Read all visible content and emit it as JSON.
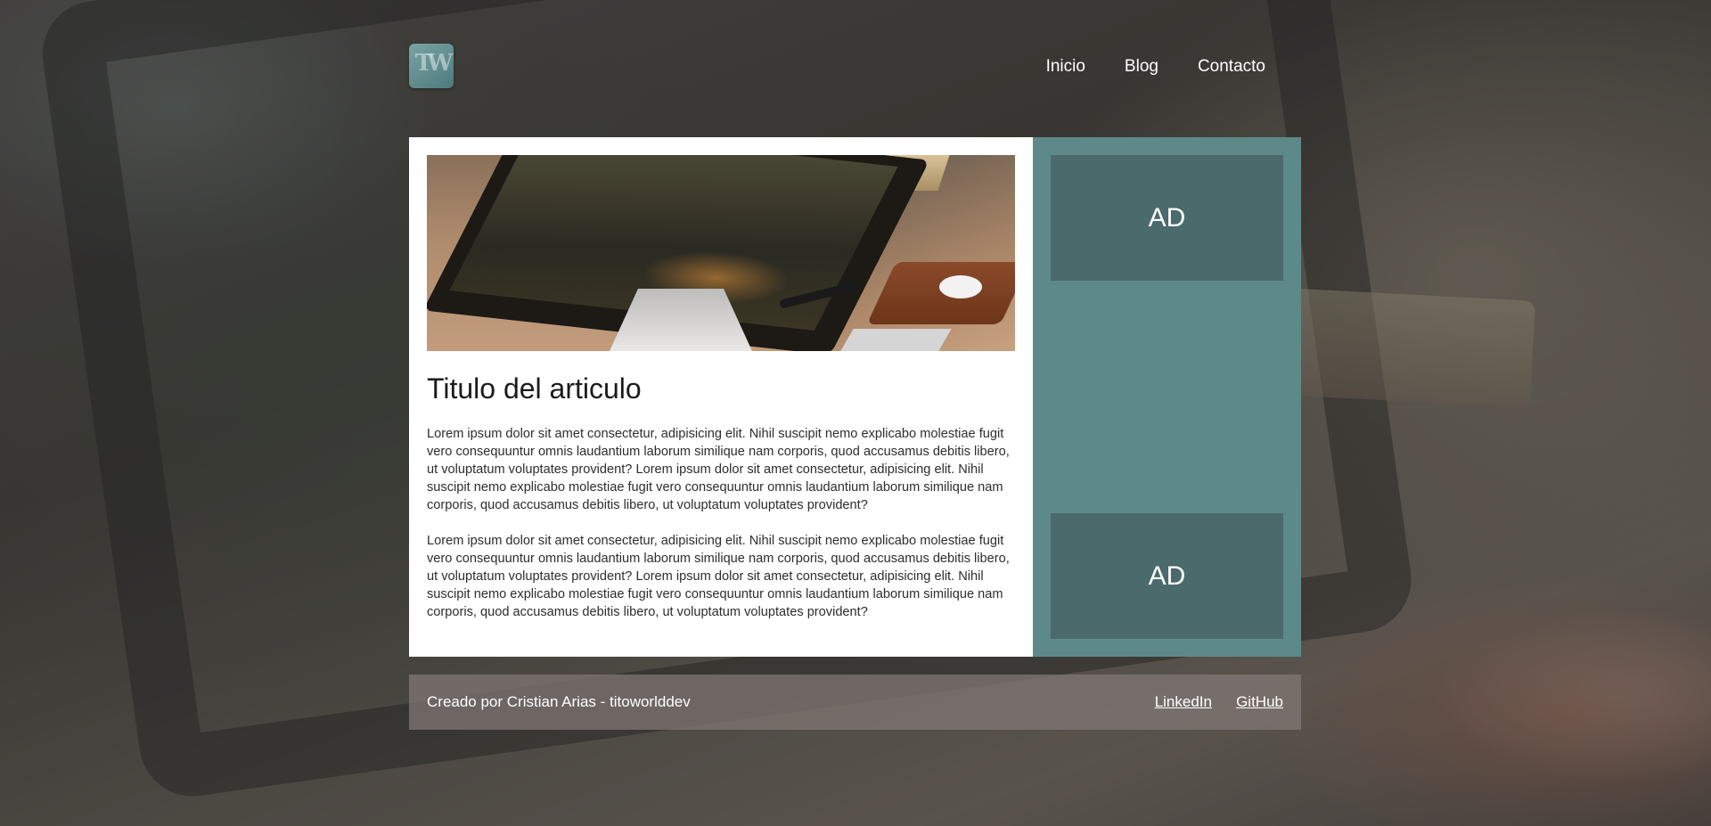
{
  "header": {
    "logo_text": "TW",
    "nav": {
      "inicio": "Inicio",
      "blog": "Blog",
      "contacto": "Contacto"
    }
  },
  "article": {
    "title": "Titulo del articulo",
    "paragraphs": [
      "Lorem ipsum dolor sit amet consectetur, adipisicing elit. Nihil suscipit nemo explicabo molestiae fugit vero consequuntur omnis laudantium laborum similique nam corporis, quod accusamus debitis libero, ut voluptatum voluptates provident? Lorem ipsum dolor sit amet consectetur, adipisicing elit. Nihil suscipit nemo explicabo molestiae fugit vero consequuntur omnis laudantium laborum similique nam corporis, quod accusamus debitis libero, ut voluptatum voluptates provident?",
      "Lorem ipsum dolor sit amet consectetur, adipisicing elit. Nihil suscipit nemo explicabo molestiae fugit vero consequuntur omnis laudantium laborum similique nam corporis, quod accusamus debitis libero, ut voluptatum voluptates provident? Lorem ipsum dolor sit amet consectetur, adipisicing elit. Nihil suscipit nemo explicabo molestiae fugit vero consequuntur omnis laudantium laborum similique nam corporis, quod accusamus debitis libero, ut voluptatum voluptates provident?"
    ]
  },
  "sidebar": {
    "ads": [
      "AD",
      "AD"
    ]
  },
  "footer": {
    "credit": "Creado por Cristian Arias - titoworlddev",
    "links": {
      "linkedin": "LinkedIn",
      "github": "GitHub"
    }
  },
  "colors": {
    "sidebar_bg": "#5e8989",
    "ad_bg": "#4a6a6b",
    "article_bg": "#ffffff",
    "footer_bg": "#827876"
  }
}
